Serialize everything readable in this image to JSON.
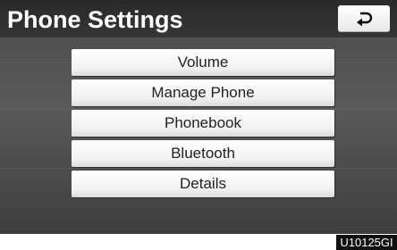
{
  "header": {
    "title": "Phone Settings",
    "back_icon": "return-arrow-icon"
  },
  "menu": {
    "items": [
      {
        "label": "Volume"
      },
      {
        "label": "Manage Phone"
      },
      {
        "label": "Phonebook"
      },
      {
        "label": "Bluetooth"
      },
      {
        "label": "Details"
      }
    ]
  },
  "footer": {
    "image_code": "U10125GI"
  },
  "colors": {
    "header_bg": "#2a2a2a",
    "screen_bg": "#4a4a4a",
    "button_bg": "#ffffff",
    "text": "#222222"
  }
}
